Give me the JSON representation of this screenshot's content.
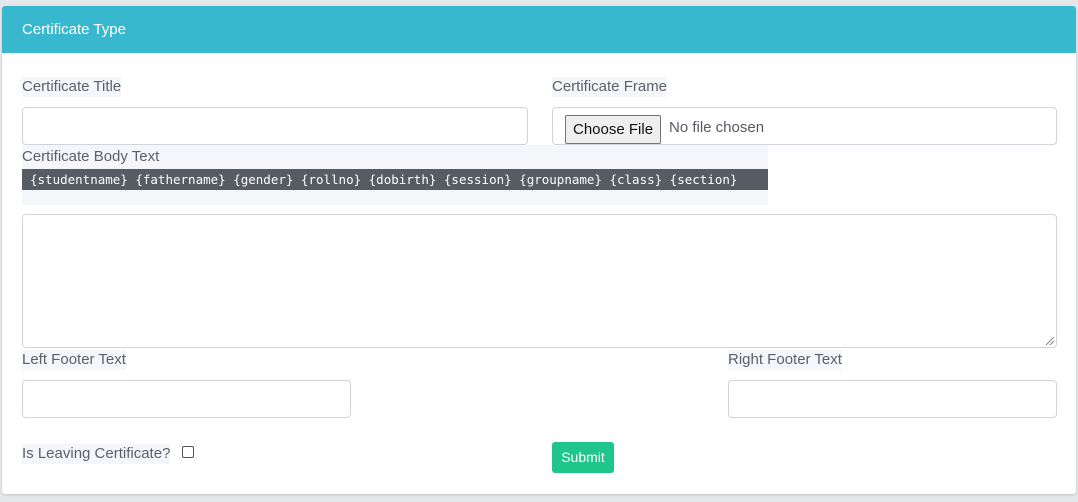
{
  "header": {
    "title": "Certificate Type"
  },
  "form": {
    "certificate_title": {
      "label": "Certificate Title",
      "value": ""
    },
    "certificate_frame": {
      "label": "Certificate Frame",
      "button_label": "Choose File",
      "status_text": "No file chosen"
    },
    "certificate_body": {
      "label": "Certificate Body Text",
      "placeholders_text": "{studentname} {fathername} {gender} {rollno} {dobirth} {session} {groupname} {class} {section}",
      "value": ""
    },
    "left_footer": {
      "label": "Left Footer Text",
      "value": ""
    },
    "right_footer": {
      "label": "Right Footer Text",
      "value": ""
    },
    "is_leaving": {
      "label": "Is Leaving Certificate?",
      "checked": false
    },
    "submit_label": "Submit"
  },
  "colors": {
    "header_bg": "#38b8cf",
    "submit_bg": "#1fc58b",
    "placeholder_bar_bg": "#575b63"
  }
}
